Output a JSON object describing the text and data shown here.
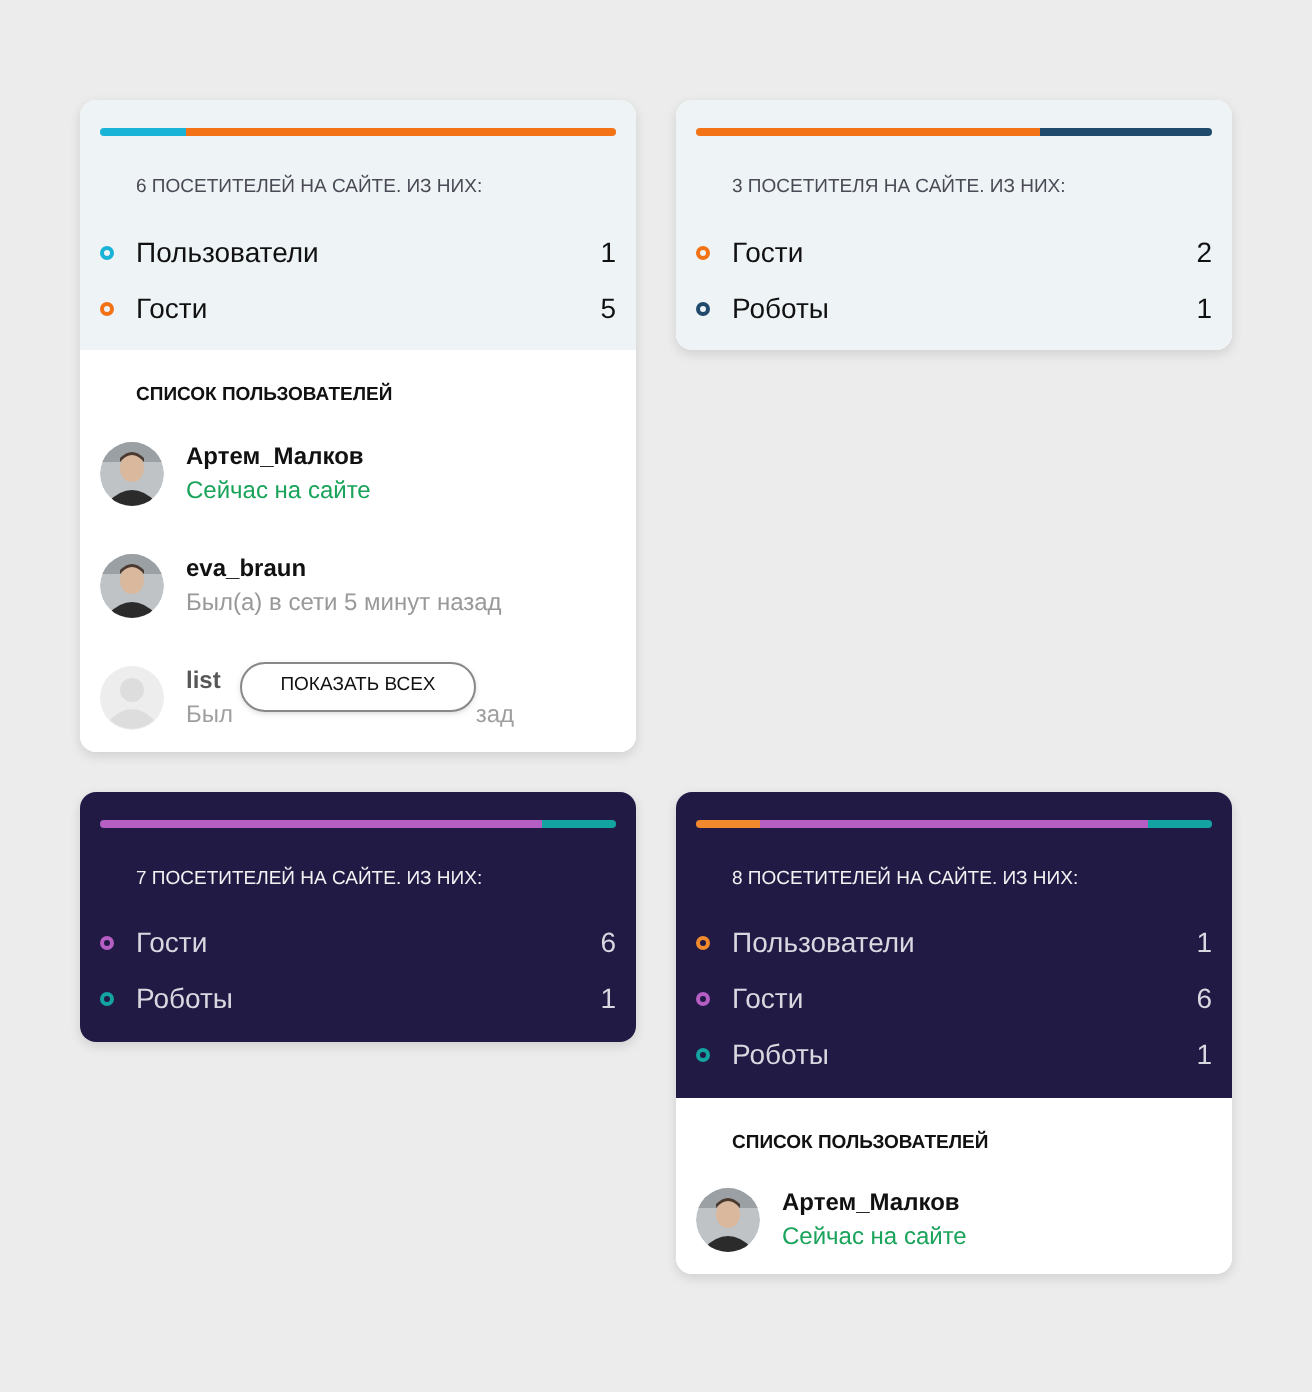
{
  "cards": [
    {
      "kind": "light",
      "summary": "6 ПОСЕТИТЕЛЕЙ НА САЙТЕ. ИЗ НИХ:",
      "groups": [
        {
          "label": "Пользователи",
          "count": "1",
          "color": "#1ab3d8"
        },
        {
          "label": "Гости",
          "count": "5",
          "color": "#f47216"
        }
      ],
      "users_title": "СПИСОК ПОЛЬЗОВАТЕЛЕЙ",
      "users": [
        {
          "name": "Артем_Малков",
          "status": "Сейчас на сайте",
          "online": true,
          "faded": false
        },
        {
          "name": "eva_braun",
          "status": "Был(а) в сети 5 минут назад",
          "online": false,
          "faded": false
        },
        {
          "name": "list",
          "status": "Был",
          "status_tail": "зад",
          "online": false,
          "kind": "placeholder",
          "faded": true
        }
      ],
      "show_all_button": "ПОКАЗАТЬ ВСЕХ"
    },
    {
      "kind": "light",
      "summary": "3 ПОСЕТИТЕЛЯ НА САЙТЕ. ИЗ НИХ:",
      "groups": [
        {
          "label": "Гости",
          "count": "2",
          "color": "#f47216"
        },
        {
          "label": "Роботы",
          "count": "1",
          "color": "#1f4a6b"
        }
      ]
    },
    {
      "kind": "dark",
      "summary": "7 ПОСЕТИТЕЛЕЙ НА САЙТЕ. ИЗ НИХ:",
      "groups": [
        {
          "label": "Гости",
          "count": "6",
          "color": "#b55ec4"
        },
        {
          "label": "Роботы",
          "count": "1",
          "color": "#13a3a0"
        }
      ]
    },
    {
      "kind": "dark",
      "summary": "8 ПОСЕТИТЕЛЕЙ НА САЙТЕ. ИЗ НИХ:",
      "groups": [
        {
          "label": "Пользователи",
          "count": "1",
          "color": "#f08a2c"
        },
        {
          "label": "Гости",
          "count": "6",
          "color": "#b55ec4"
        },
        {
          "label": "Роботы",
          "count": "1",
          "color": "#13a3a0"
        }
      ],
      "users_title": "СПИСОК ПОЛЬЗОВАТЕЛЕЙ",
      "users": [
        {
          "name": "Артем_Малков",
          "status": "Сейчас на сайте",
          "online": true,
          "faded": false
        }
      ]
    }
  ]
}
